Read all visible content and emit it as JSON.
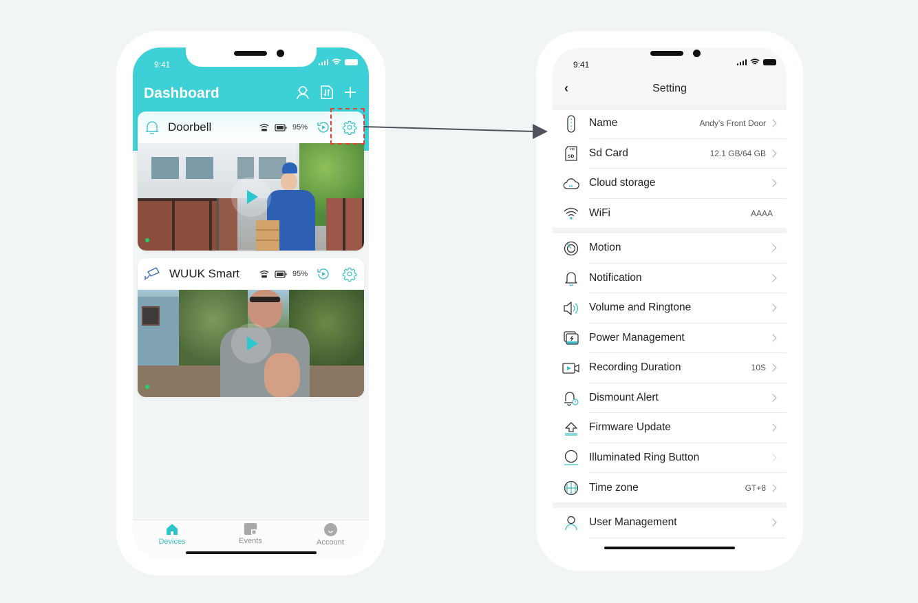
{
  "left_phone": {
    "status_time": "9:41",
    "header": {
      "title": "Dashboard",
      "actions": [
        {
          "icon": "customer-service-icon"
        },
        {
          "icon": "transfer-icon"
        },
        {
          "icon": "plus-icon"
        }
      ]
    },
    "devices": [
      {
        "name": "Doorbell",
        "type_icon": "bell-icon",
        "battery": "95%",
        "live": true
      },
      {
        "name": "WUUK Smart",
        "type_icon": "camera-icon",
        "battery": "95%",
        "live": true
      }
    ],
    "tabbar": [
      {
        "label": "Devices",
        "icon": "home-icon",
        "active": true
      },
      {
        "label": "Events",
        "icon": "events-icon",
        "active": false
      },
      {
        "label": "Account",
        "icon": "account-icon",
        "active": false
      }
    ]
  },
  "right_phone": {
    "status_time": "9:41",
    "title": "Setting",
    "groups": [
      [
        {
          "label": "Name",
          "value": "Andy’s Front Door",
          "icon": "tag-icon",
          "chevron": true
        },
        {
          "label": "Sd Card",
          "value": "12.1 GB/64 GB",
          "icon": "sd-card-icon",
          "chevron": true
        },
        {
          "label": "Cloud storage",
          "value": "",
          "icon": "cloud-icon",
          "chevron": true
        },
        {
          "label": "WiFi",
          "value": "AAAA",
          "icon": "wifi-icon",
          "chevron": false
        }
      ],
      [
        {
          "label": "Motion",
          "value": "",
          "icon": "motion-icon",
          "chevron": true
        },
        {
          "label": "Notification",
          "value": "",
          "icon": "bell-icon",
          "chevron": true
        },
        {
          "label": "Volume and Ringtone",
          "value": "",
          "icon": "speaker-icon",
          "chevron": true
        },
        {
          "label": "Power Management",
          "value": "",
          "icon": "power-icon",
          "chevron": true
        },
        {
          "label": "Recording Duration",
          "value": "10S",
          "icon": "video-icon",
          "chevron": true
        },
        {
          "label": "Dismount Alert",
          "value": "",
          "icon": "alert-bell-icon",
          "chevron": true
        },
        {
          "label": "Firmware Update",
          "value": "",
          "icon": "upload-icon",
          "chevron": true
        },
        {
          "label": "Illuminated Ring Button",
          "value": "",
          "icon": "ring-icon",
          "chevron": true
        },
        {
          "label": "Time zone",
          "value": "GT+8",
          "icon": "globe-icon",
          "chevron": true
        }
      ],
      [
        {
          "label": "User Management",
          "value": "",
          "icon": "user-icon",
          "chevron": true
        }
      ]
    ]
  },
  "colors": {
    "accent": "#3dd0d6",
    "accent_dark": "#3bbfc7",
    "annotation": "#e53f34",
    "arrow": "#4e535d",
    "background": "#f1f5f6",
    "live": "#22d36a"
  }
}
